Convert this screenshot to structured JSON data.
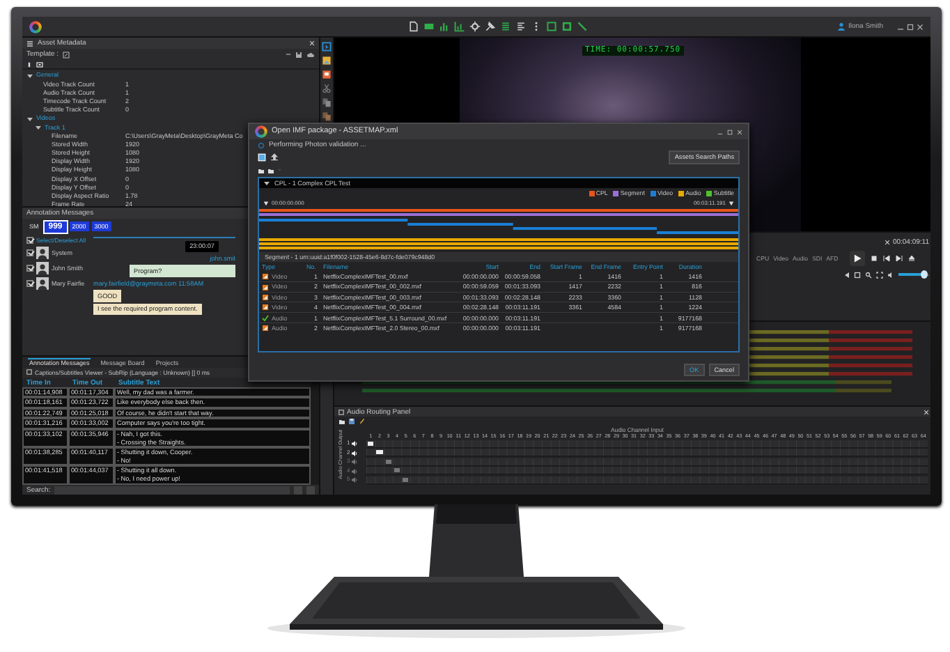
{
  "top_bar": {
    "user": "Ilona Smith"
  },
  "metadata": {
    "title": "Asset Metadata",
    "template_label": "Template :",
    "tree": [
      {
        "label": "General",
        "expanded": true,
        "children": [
          {
            "label": "Video Track Count",
            "value": "1"
          },
          {
            "label": "Audio Track Count",
            "value": "1"
          },
          {
            "label": "Timecode Track Count",
            "value": "2"
          },
          {
            "label": "Subtitle Track Count",
            "value": "0"
          }
        ]
      },
      {
        "label": "Videos",
        "expanded": true,
        "children": [
          {
            "label": "Track 1",
            "expanded": true,
            "children": [
              {
                "label": "Filename",
                "value": "C:\\Users\\GrayMeta\\Desktop\\GrayMeta Co"
              },
              {
                "label": "Stored Width",
                "value": "1920"
              },
              {
                "label": "Stored Height",
                "value": "1080"
              },
              {
                "label": "Display Width",
                "value": "1920"
              },
              {
                "label": "Display Height",
                "value": "1080"
              },
              {
                "label": "Display X Offset",
                "value": "0"
              },
              {
                "label": "Display Y Offset",
                "value": "0"
              },
              {
                "label": "Display Aspect Ratio",
                "value": "1.78"
              },
              {
                "label": "Frame Rate",
                "value": "24"
              }
            ]
          }
        ]
      }
    ]
  },
  "annotations": {
    "title": "Annotation Messages",
    "tabs": [
      {
        "label": "SM",
        "kind": "plain",
        "selected": false
      },
      {
        "label": "999",
        "kind": "channel",
        "selected": true
      },
      {
        "label": "2000",
        "kind": "channel",
        "selected": false
      },
      {
        "label": "3000",
        "kind": "channel",
        "selected": false
      }
    ],
    "select_all": {
      "label": "Select/Deselect All",
      "checked": true
    },
    "users": [
      {
        "name": "System",
        "checked": true
      },
      {
        "name": "John Smith",
        "checked": true
      },
      {
        "name": "Mary Fairfie",
        "checked": true
      }
    ],
    "messages": [
      {
        "kind": "stamp",
        "text": "23:00:07"
      },
      {
        "kind": "sender",
        "text": "john.smit"
      },
      {
        "kind": "outgoing",
        "text": "Program?"
      },
      {
        "kind": "author",
        "text": "mary.fairfield@graymeta.com  11:58AM"
      },
      {
        "kind": "incoming",
        "text": "GOOD"
      },
      {
        "kind": "incoming",
        "text": "I see the required program content."
      }
    ]
  },
  "panel_tabs": [
    {
      "label": "Annotation Messages",
      "selected": true
    },
    {
      "label": "Message Board",
      "selected": false
    },
    {
      "label": "Projects",
      "selected": false
    }
  ],
  "subtitles": {
    "title": "Captions/Subtitles Viewer - SubRip (Language : Unknown) [] 0 ms",
    "columns": [
      "Time In",
      "Time Out",
      "Subtitle Text"
    ],
    "rows": [
      {
        "time_in": "00:01:14,908",
        "time_out": "00:01:17,304",
        "lines": [
          "Well, my dad was a farmer."
        ]
      },
      {
        "time_in": "00:01:18,161",
        "time_out": "00:01:23,722",
        "lines": [
          "Like everybody else back then."
        ]
      },
      {
        "time_in": "00:01:22,749",
        "time_out": "00:01:25,018",
        "lines": [
          "Of course, he didn't start that way."
        ]
      },
      {
        "time_in": "00:01:31,216",
        "time_out": "00:01:33,002",
        "lines": [
          "Computer says you're too tight."
        ]
      },
      {
        "time_in": "00:01:33,102",
        "time_out": "00:01:35,946",
        "lines": [
          "- Nah, I got this.",
          "- Crossing the Straights."
        ]
      },
      {
        "time_in": "00:01:38,285",
        "time_out": "00:01:40,117",
        "lines": [
          "- Shutting it down, Cooper.",
          "- No!"
        ]
      },
      {
        "time_in": "00:01:41,518",
        "time_out": "00:01:44,037",
        "lines": [
          "- Shutting it all down.",
          "- No, I need power up!"
        ]
      }
    ],
    "search_label": "Search:"
  },
  "video": {
    "timecode": "TIME: 00:00:57.750"
  },
  "transport": {
    "timecode": "00:04:09:11",
    "indicators": [
      "CPU",
      "Video",
      "Audio",
      "SDI",
      "AFD"
    ],
    "volume": {
      "level": 0.85
    }
  },
  "routing": {
    "title": "Audio Routing Panel",
    "input_label": "Audio Channel Input",
    "output_label": "Audio Channel Output",
    "inputs": [
      "1",
      "2",
      "3",
      "4",
      "5",
      "6",
      "7",
      "8",
      "9",
      "10",
      "11",
      "12",
      "13",
      "14",
      "15",
      "16",
      "17",
      "18",
      "19",
      "20",
      "21",
      "22",
      "23",
      "24",
      "25",
      "26",
      "27",
      "28",
      "29",
      "30",
      "31",
      "32",
      "33",
      "34",
      "35",
      "36",
      "37",
      "38",
      "39",
      "40",
      "41",
      "42",
      "43",
      "44",
      "45",
      "46",
      "47",
      "48",
      "49",
      "50",
      "51",
      "52",
      "53",
      "54",
      "55",
      "56",
      "57",
      "58",
      "59",
      "60",
      "61",
      "62",
      "63",
      "64"
    ],
    "outputs": [
      {
        "label": "1",
        "enabled": true
      },
      {
        "label": "2",
        "enabled": true
      },
      {
        "label": "3",
        "enabled": false
      },
      {
        "label": "4",
        "enabled": false
      },
      {
        "label": "5",
        "enabled": false
      }
    ]
  },
  "dialog": {
    "title": "Open IMF package - ASSETMAP.xml",
    "status": "Performing Photon validation ...",
    "search_paths_button": "Assets Search Paths",
    "cpl": {
      "title": "CPL - 1 Complex CPL Test",
      "expanded": true,
      "legend": [
        {
          "label": "CPL",
          "color": "#e8541c"
        },
        {
          "label": "Segment",
          "color": "#9b6fd6"
        },
        {
          "label": "Video",
          "color": "#1a7fd4"
        },
        {
          "label": "Audio",
          "color": "#e8a800"
        },
        {
          "label": "Subtitle",
          "color": "#4fc02e"
        }
      ],
      "start_time": "00:00:00.000",
      "end_time": "00:03:11.191",
      "segment": "Segment - 1   urn:uuid:a1f0f002-1528-45e6-8d7c-fde079c948d0",
      "columns": [
        "Type",
        "No.",
        "Filename",
        "Start",
        "End",
        "Start Frame",
        "End Frame",
        "Entry Point",
        "Duration"
      ],
      "rows": [
        {
          "kind": "warning",
          "cells": [
            "Video",
            "1",
            "NetflixComplexIMFTest_00.mxf",
            "00:00:00.000",
            "00:00:59.058",
            "1",
            "1416",
            "1",
            "1416"
          ]
        },
        {
          "kind": "warning",
          "cells": [
            "Video",
            "2",
            "NetflixComplexIMFTest_00_002.mxf",
            "00:00:59.059",
            "00:01:33.093",
            "1417",
            "2232",
            "1",
            "816"
          ]
        },
        {
          "kind": "warning",
          "cells": [
            "Video",
            "3",
            "NetflixComplexIMFTest_00_003.mxf",
            "00:01:33.093",
            "00:02:28.148",
            "2233",
            "3360",
            "1",
            "1128"
          ]
        },
        {
          "kind": "warning",
          "cells": [
            "Video",
            "4",
            "NetflixComplexIMFTest_00_004.mxf",
            "00:02:28.148",
            "00:03:11.191",
            "3361",
            "4584",
            "1",
            "1224"
          ]
        },
        {
          "kind": "ok",
          "cells": [
            "Audio",
            "1",
            "NetflixComplexIMFTest_5.1 Surround_00.mxf",
            "00:00:00.000",
            "00:03:11.191",
            "",
            "",
            "1",
            "9177168"
          ]
        },
        {
          "kind": "warning",
          "cells": [
            "Audio",
            "2",
            "NetflixComplexIMFTest_2.0 Stereo_00.mxf",
            "00:00:00.000",
            "00:03:11.191",
            "",
            "",
            "1",
            "9177168"
          ]
        }
      ]
    },
    "buttons": [
      "OK",
      "Cancel"
    ]
  }
}
